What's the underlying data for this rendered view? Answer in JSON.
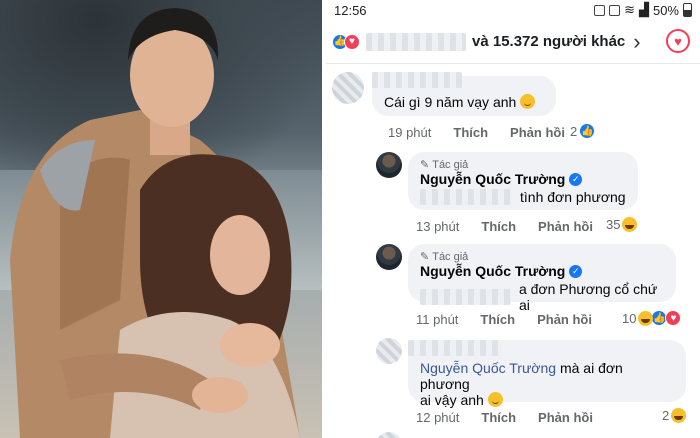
{
  "status": {
    "time": "12:56",
    "battery": "50%"
  },
  "reactions": {
    "others_text": "và 15.372 người khác"
  },
  "comments": [
    {
      "text": "Cái gì 9 năm vạy anh",
      "time": "19 phút",
      "like": "Thích",
      "reply": "Phản hồi",
      "count": "2"
    },
    {
      "tag": "Tác giả",
      "author": "Nguyễn Quốc Trường",
      "text": "tình đơn phương",
      "time": "13 phút",
      "like": "Thích",
      "reply": "Phản hồi",
      "count": "35"
    },
    {
      "tag": "Tác giả",
      "author": "Nguyễn Quốc Trường",
      "text": "a đơn Phương cổ chứ ai",
      "time": "11 phút",
      "like": "Thích",
      "reply": "Phản hồi",
      "count": "10"
    },
    {
      "mention": "Nguyễn Quốc Trường",
      "text1": "mà ai đơn phương",
      "text2": "ai vậy anh",
      "time": "12 phút",
      "like": "Thích",
      "reply": "Phản hồi",
      "count": "2"
    }
  ],
  "colors": {
    "facebook_blue": "#1877f2",
    "love_red": "#f33e58",
    "bubble_bg": "#f0f2f5"
  }
}
